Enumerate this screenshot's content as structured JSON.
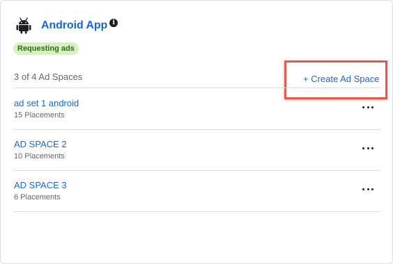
{
  "app": {
    "title": "Android App",
    "icon": "android-icon",
    "info_icon_glyph": "i",
    "status": "Requesting ads"
  },
  "ad_spaces": {
    "count_label": "3 of 4 Ad Spaces",
    "create_label": "+ Create Ad Space",
    "items": [
      {
        "name": "ad set 1 android",
        "placements": "15 Placements"
      },
      {
        "name": "AD SPACE 2",
        "placements": "10 Placements"
      },
      {
        "name": "AD SPACE 3",
        "placements": "6 Placements"
      }
    ]
  },
  "colors": {
    "link": "#1a67d2",
    "badge_bg": "#d6f2c3",
    "badge_text": "#2e6b12",
    "highlight": "#e8574a"
  }
}
